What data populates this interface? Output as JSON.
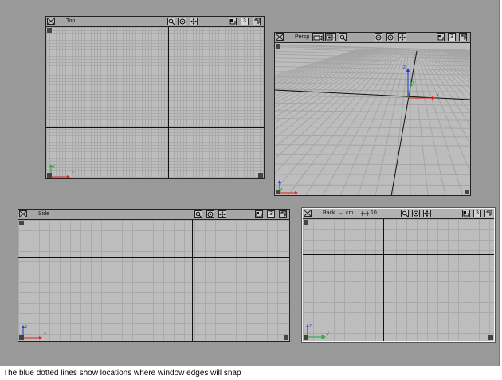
{
  "caption": "The blue dotted lines show locations where window edges will snap",
  "icons": {
    "close": "close-x-icon",
    "zoom": "magnifier-icon",
    "dolly": "dolly-icon",
    "pan": "pan-arrows-icon",
    "maximize": "maximize-icon",
    "layout": "layout-icon",
    "camera": "camera-icon",
    "stepper": "stepper-icon"
  },
  "colors": {
    "x_axis": "#e0201c",
    "y_axis": "#22a53b",
    "z_axis": "#2033d8"
  },
  "viewports": {
    "top": {
      "title": "Top",
      "num": "3",
      "axis_h": "x",
      "axis_v": "y"
    },
    "persp": {
      "title": "Persp",
      "num": "3",
      "axis_x": "x",
      "axis_y": "y",
      "axis_z": "z"
    },
    "side": {
      "title": "Side",
      "num": "3",
      "axis_h": "x",
      "axis_v": "z"
    },
    "back": {
      "title": "Back",
      "units_arrow": "↔",
      "units": "cm",
      "spacing_value": "10",
      "num": "3",
      "axis_h": "y",
      "axis_v": "z"
    }
  }
}
